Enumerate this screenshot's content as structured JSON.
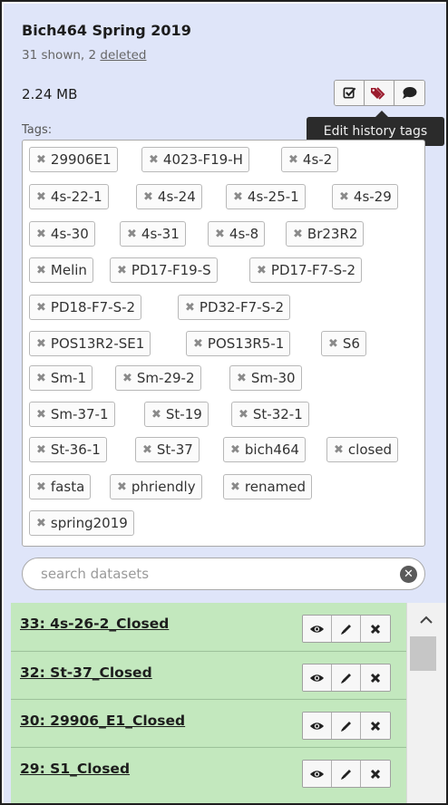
{
  "history": {
    "name": "Bich464 Spring 2019",
    "shown_text": "31 shown, 2 ",
    "deleted_link": "deleted",
    "size": "2.24 MB"
  },
  "tooltip": "Edit history tags",
  "tags_label": "Tags:",
  "tags": [
    "29906E1",
    "4023-F19-H",
    "4s-2",
    "4s-22-1",
    "4s-24",
    "4s-25-1",
    "4s-29",
    "4s-30",
    "4s-31",
    "4s-8",
    "Br23R2",
    "Melin",
    "PD17-F19-S",
    "PD17-F7-S-2",
    "PD18-F7-S-2",
    "PD32-F7-S-2",
    "POS13R2-SE1",
    "POS13R5-1",
    "S6",
    "Sm-1",
    "Sm-29-2",
    "Sm-30",
    "Sm-37-1",
    "St-19",
    "St-32-1",
    "St-36-1",
    "St-37",
    "bich464",
    "closed",
    "fasta",
    "phriendly",
    "renamed",
    "spring2019"
  ],
  "search": {
    "placeholder": "search datasets"
  },
  "datasets": [
    {
      "title": "33: 4s-26-2_Closed"
    },
    {
      "title": "32: St-37_Closed"
    },
    {
      "title": "30: 29906_E1_Closed"
    },
    {
      "title": "29: S1_Closed"
    }
  ],
  "icons": {
    "select": "checkbox-icon",
    "tags": "tags-icon",
    "annotate": "comment-icon",
    "view": "eye-icon",
    "edit": "pencil-icon",
    "delete": "close-icon",
    "clear": "clear-search-icon",
    "scroll_up": "chevron-up-icon"
  },
  "colors": {
    "panel_bg": "#dfe5f9",
    "dataset_ok_bg": "#c3e8be",
    "tags_icon": "#9b1c2e",
    "tooltip_bg": "#2b2b2b"
  }
}
